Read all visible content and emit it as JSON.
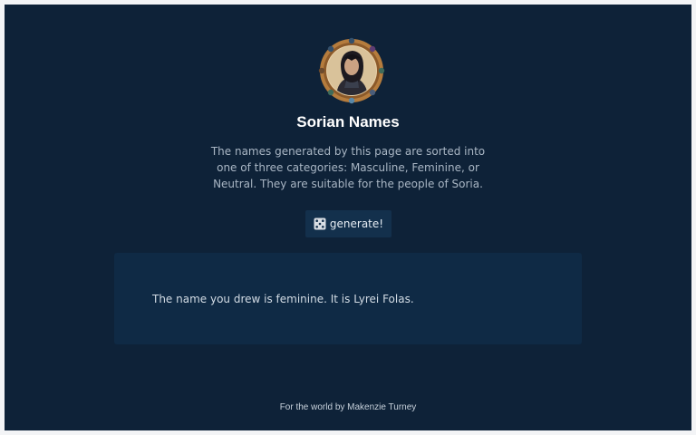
{
  "page": {
    "title": "Sorian Names",
    "description": "The names generated by this page are sorted into one of three categories: Masculine, Feminine, or Neutral. They are suitable for the people of Soria.",
    "generate_button": {
      "icon": "dice-icon",
      "label": "generate!"
    },
    "result": "The name you drew is feminine. It is Lyrei Folas.",
    "footer": "For the world by Makenzie Turney"
  },
  "colors": {
    "background": "#0e2238",
    "card": "#0f2a45",
    "button": "#13304c",
    "avatar_ring": "#b07a3c"
  }
}
